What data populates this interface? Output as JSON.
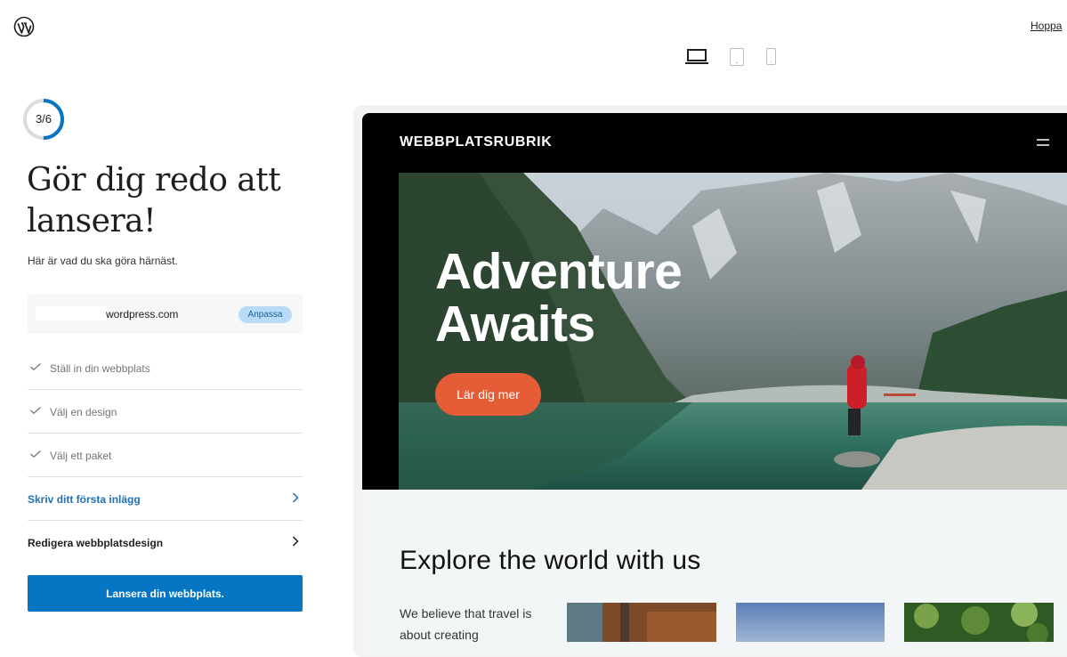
{
  "topbar": {
    "skip_label": "Hoppa"
  },
  "device_switcher": {
    "options": [
      "laptop-icon",
      "tablet-icon",
      "phone-icon"
    ],
    "selected": "laptop-icon"
  },
  "progress": {
    "label": "3/6",
    "value": 0.5,
    "color": "#0675c4"
  },
  "sidebar": {
    "title": "Gör dig redo att lansera!",
    "subtitle": "Här är vad du ska göra härnäst.",
    "domain": {
      "suffix": "wordpress.com",
      "badge": "Anpassa"
    },
    "tasks": [
      {
        "label": "Ställ in din webbplats",
        "done": true
      },
      {
        "label": "Välj en design",
        "done": true
      },
      {
        "label": "Välj ett paket",
        "done": true
      },
      {
        "label": "Skriv ditt första inlägg",
        "done": false
      },
      {
        "label": "Redigera webbplatsdesign",
        "done": false
      }
    ],
    "launch_label": "Lansera din webbplats."
  },
  "preview": {
    "site_title": "WEBBPLATSRUBRIK",
    "hero_line1": "Adventure",
    "hero_line2": "Awaits",
    "hero_button": "Lär dig mer",
    "section_heading": "Explore the world with us",
    "body_text": "We believe that travel is about creating"
  },
  "colors": {
    "accent": "#0675c4",
    "hero_button": "#e55c36",
    "badge_bg": "#b8dcf7"
  }
}
